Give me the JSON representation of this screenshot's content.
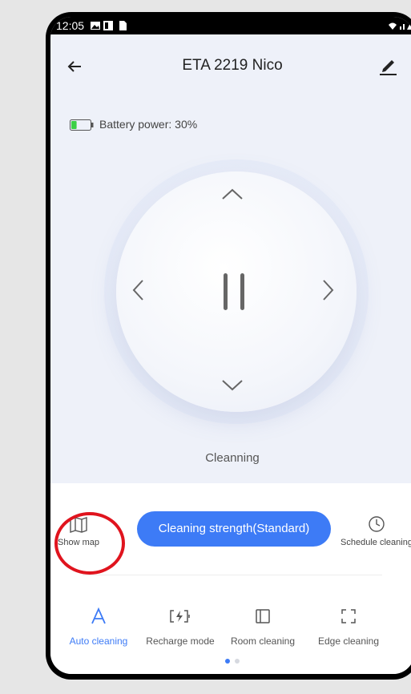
{
  "status_bar": {
    "time": "12:05"
  },
  "header": {
    "title": "ETA 2219 Nico"
  },
  "battery": {
    "label": "Battery power: 30%",
    "level": 0.3
  },
  "joystick": {
    "status": "Cleanning"
  },
  "controls": {
    "show_map": "Show map",
    "strength_button": "Cleaning strength(Standard)",
    "schedule": "Schedule cleaning"
  },
  "modes": [
    {
      "label": "Auto cleaning",
      "icon": "letter-a-icon",
      "active": true
    },
    {
      "label": "Recharge mode",
      "icon": "recharge-icon",
      "active": false
    },
    {
      "label": "Room cleaning",
      "icon": "room-icon",
      "active": false
    },
    {
      "label": "Edge cleaning",
      "icon": "edge-icon",
      "active": false
    }
  ],
  "pager": {
    "pages": 2,
    "current": 1
  },
  "colors": {
    "accent": "#3d7bf6",
    "highlight_circle": "#e0141e",
    "battery": "#3ccf45"
  }
}
